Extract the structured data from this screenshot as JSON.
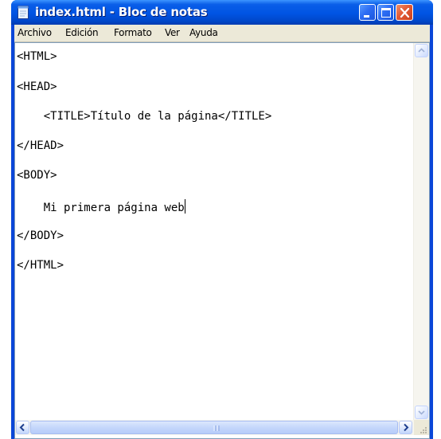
{
  "window": {
    "title": "index.html - Bloc de notas",
    "title_icon": "notepad-icon",
    "buttons": [
      "minimize-button",
      "maximize-button",
      "close-button"
    ]
  },
  "menubar": {
    "items": [
      "Archivo",
      "Edición",
      "Formato",
      "Ver",
      "Ayuda"
    ]
  },
  "editor": {
    "lines": [
      "<HTML>",
      "<HEAD>",
      "    <TITLE>Título de la página</TITLE>",
      "</HEAD>",
      "<BODY>",
      "    Mi primera página web",
      "</BODY>",
      "</HTML>"
    ]
  },
  "colors": {
    "titlebar": "#0054e3",
    "close_button": "#e35a35",
    "menubar": "#ece9d8",
    "editor_background": "#ffffff"
  }
}
